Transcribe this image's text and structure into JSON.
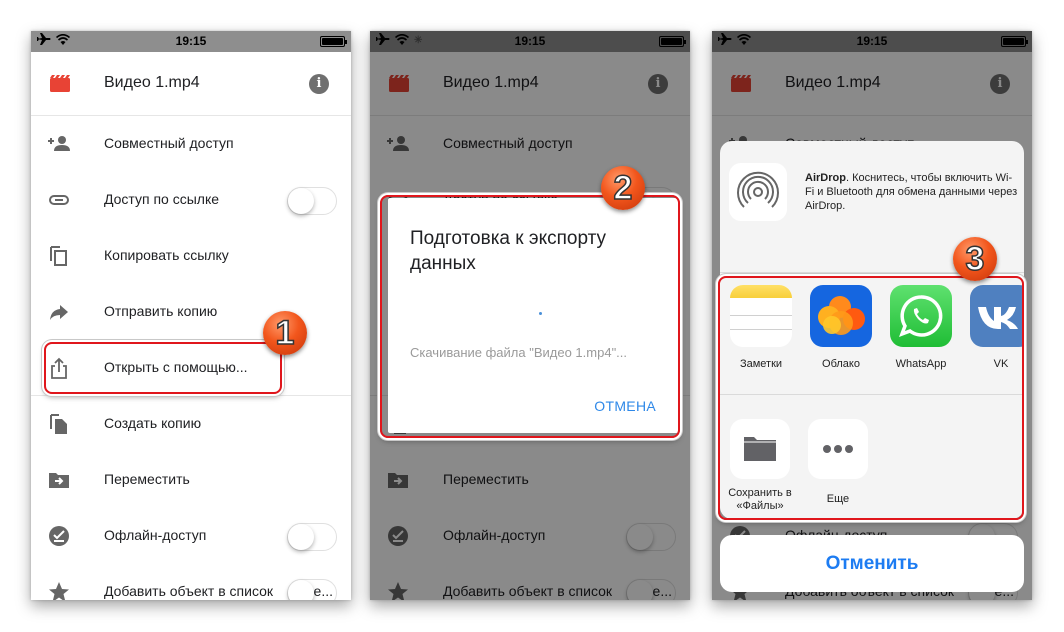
{
  "status_bar": {
    "time": "19:15",
    "icons": [
      "airplane-icon",
      "wifi-icon",
      "battery-icon"
    ]
  },
  "file": {
    "name": "Видео 1.mp4",
    "icon": "video-file-icon",
    "info_icon": "info-icon",
    "info_glyph": "i"
  },
  "menu": {
    "items": [
      {
        "label": "Совместный доступ",
        "icon": "add-person-icon"
      },
      {
        "label": "Доступ по ссылке",
        "icon": "link-icon",
        "toggle": false
      },
      {
        "label": "Копировать ссылку",
        "icon": "copy-icon"
      },
      {
        "label": "Отправить копию",
        "icon": "share-arrow-icon"
      },
      {
        "label": "Открыть с помощью...",
        "icon": "open-with-icon"
      },
      {
        "label": "Создать копию",
        "icon": "duplicate-icon"
      },
      {
        "label": "Переместить",
        "icon": "move-folder-icon"
      },
      {
        "label": "Офлайн-доступ",
        "icon": "offline-icon",
        "toggle": false
      },
      {
        "label": "Добавить объект в список",
        "icon": "star-icon",
        "toggle": false,
        "tail": "е..."
      }
    ]
  },
  "badges": {
    "step1": "1",
    "step2": "2",
    "step3": "3"
  },
  "dialog": {
    "title": "Подготовка к экспорту данных",
    "status": "Скачивание файла \"Видео 1.mp4\"...",
    "cancel_label": "ОТМЕНА"
  },
  "share_sheet": {
    "airdrop": {
      "title": "AirDrop",
      "text": ". Коснитесь, чтобы включить Wi-Fi и Bluetooth для обмена данными через AirDrop."
    },
    "apps": [
      {
        "label": "Заметки",
        "icon": "notes-app-icon"
      },
      {
        "label": "Облако",
        "icon": "cloud-app-icon"
      },
      {
        "label": "WhatsApp",
        "icon": "whatsapp-app-icon"
      },
      {
        "label": "VK",
        "icon": "vk-app-icon"
      }
    ],
    "actions": [
      {
        "label": "Сохранить в «Файлы»",
        "icon": "folder-icon"
      },
      {
        "label": "Еще",
        "icon": "more-icon"
      }
    ],
    "cancel_label": "Отменить"
  },
  "colors": {
    "highlight": "#e0161c",
    "dialog_accent": "#2e88e8",
    "sheet_accent": "#1d7cf2",
    "badge": "#f2561c",
    "video_icon": "#e84335"
  }
}
